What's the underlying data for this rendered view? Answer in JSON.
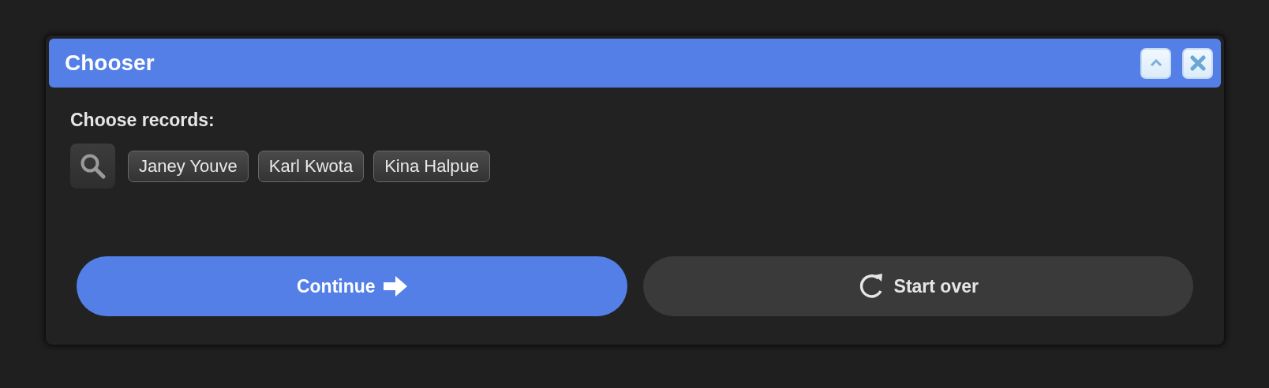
{
  "window": {
    "title": "Chooser"
  },
  "prompt": "Choose records:",
  "records": [
    {
      "label": "Janey Youve"
    },
    {
      "label": "Karl Kwota"
    },
    {
      "label": "Kina Halpue"
    }
  ],
  "buttons": [
    {
      "kind": "primary",
      "label": "Continue"
    },
    {
      "kind": "secondary",
      "label": "Start over"
    }
  ]
}
